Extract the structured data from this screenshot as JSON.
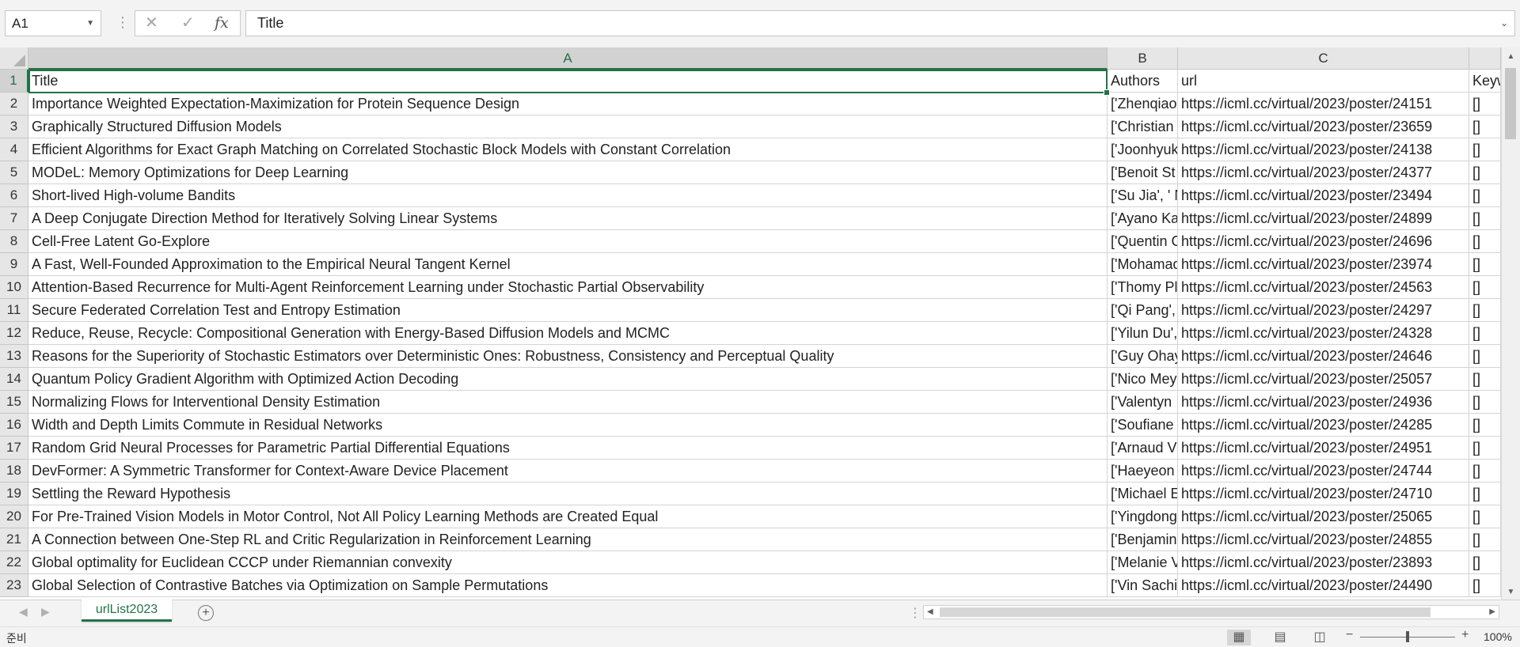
{
  "formula_bar": {
    "name_box": "A1",
    "cancel_icon": "✕",
    "enter_icon": "✓",
    "fx_label": "fx",
    "formula": "Title"
  },
  "columns": [
    {
      "id": "A",
      "label": "A"
    },
    {
      "id": "B",
      "label": "B"
    },
    {
      "id": "C",
      "label": "C"
    },
    {
      "id": "D",
      "label": ""
    }
  ],
  "rows": [
    {
      "num": "1",
      "cells": [
        "Title",
        "Authors",
        "url",
        "Keyw"
      ]
    },
    {
      "num": "2",
      "cells": [
        "Importance Weighted Expectation-Maximization for Protein Sequence Design",
        "['Zhenqiao",
        "https://icml.cc/virtual/2023/poster/24151",
        "[]"
      ]
    },
    {
      "num": "3",
      "cells": [
        "Graphically Structured Diffusion Models",
        "['Christian",
        "https://icml.cc/virtual/2023/poster/23659",
        "[]"
      ]
    },
    {
      "num": "4",
      "cells": [
        "Efficient Algorithms for Exact Graph Matching on Correlated Stochastic Block Models with Constant Correlation",
        "['Joonhyuk",
        "https://icml.cc/virtual/2023/poster/24138",
        "[]"
      ]
    },
    {
      "num": "5",
      "cells": [
        "MODeL: Memory Optimizations for Deep Learning",
        "['Benoit St",
        "https://icml.cc/virtual/2023/poster/24377",
        "[]"
      ]
    },
    {
      "num": "6",
      "cells": [
        "Short-lived High-volume Bandits",
        "['Su Jia', ' N",
        "https://icml.cc/virtual/2023/poster/23494",
        "[]"
      ]
    },
    {
      "num": "7",
      "cells": [
        "A Deep Conjugate Direction Method for Iteratively Solving Linear Systems",
        "['Ayano Ka",
        "https://icml.cc/virtual/2023/poster/24899",
        "[]"
      ]
    },
    {
      "num": "8",
      "cells": [
        "Cell-Free Latent Go-Explore",
        "['Quentin G",
        "https://icml.cc/virtual/2023/poster/24696",
        "[]"
      ]
    },
    {
      "num": "9",
      "cells": [
        "A Fast, Well-Founded Approximation to the Empirical Neural Tangent Kernel",
        "['Mohamad",
        "https://icml.cc/virtual/2023/poster/23974",
        "[]"
      ]
    },
    {
      "num": "10",
      "cells": [
        "Attention-Based Recurrence for Multi-Agent Reinforcement Learning under Stochastic Partial Observability",
        "['Thomy Pl",
        "https://icml.cc/virtual/2023/poster/24563",
        "[]"
      ]
    },
    {
      "num": "11",
      "cells": [
        "Secure Federated Correlation Test and Entropy Estimation",
        "['Qi Pang',",
        "https://icml.cc/virtual/2023/poster/24297",
        "[]"
      ]
    },
    {
      "num": "12",
      "cells": [
        "Reduce, Reuse, Recycle: Compositional Generation with Energy-Based Diffusion Models and MCMC",
        "['Yilun Du',",
        "https://icml.cc/virtual/2023/poster/24328",
        "[]"
      ]
    },
    {
      "num": "13",
      "cells": [
        "Reasons for the Superiority of Stochastic Estimators over Deterministic Ones: Robustness, Consistency and Perceptual Quality",
        "['Guy Ohay",
        "https://icml.cc/virtual/2023/poster/24646",
        "[]"
      ]
    },
    {
      "num": "14",
      "cells": [
        "Quantum Policy Gradient Algorithm with Optimized Action Decoding",
        "['Nico Mey",
        "https://icml.cc/virtual/2023/poster/25057",
        "[]"
      ]
    },
    {
      "num": "15",
      "cells": [
        "Normalizing Flows for Interventional Density Estimation",
        "['Valentyn",
        "https://icml.cc/virtual/2023/poster/24936",
        "[]"
      ]
    },
    {
      "num": "16",
      "cells": [
        "Width and Depth Limits Commute in Residual Networks",
        "['Soufiane",
        "https://icml.cc/virtual/2023/poster/24285",
        "[]"
      ]
    },
    {
      "num": "17",
      "cells": [
        "Random Grid Neural Processes for Parametric Partial Differential Equations",
        "['Arnaud V",
        "https://icml.cc/virtual/2023/poster/24951",
        "[]"
      ]
    },
    {
      "num": "18",
      "cells": [
        "DevFormer: A Symmetric Transformer for Context-Aware Device Placement",
        "['Haeyeon",
        "https://icml.cc/virtual/2023/poster/24744",
        "[]"
      ]
    },
    {
      "num": "19",
      "cells": [
        "Settling the Reward Hypothesis",
        "['Michael E",
        "https://icml.cc/virtual/2023/poster/24710",
        "[]"
      ]
    },
    {
      "num": "20",
      "cells": [
        "For Pre-Trained Vision Models in Motor Control, Not All Policy Learning Methods are Created Equal",
        "['Yingdong",
        "https://icml.cc/virtual/2023/poster/25065",
        "[]"
      ]
    },
    {
      "num": "21",
      "cells": [
        "A Connection between One-Step RL and Critic Regularization in Reinforcement Learning",
        "['Benjamin",
        "https://icml.cc/virtual/2023/poster/24855",
        "[]"
      ]
    },
    {
      "num": "22",
      "cells": [
        "Global optimality for Euclidean CCCP under Riemannian convexity",
        "['Melanie V",
        "https://icml.cc/virtual/2023/poster/23893",
        "[]"
      ]
    },
    {
      "num": "23",
      "cells": [
        "Global Selection of Contrastive Batches via Optimization on Sample Permutations",
        "['Vin Sachi",
        "https://icml.cc/virtual/2023/poster/24490",
        "[]"
      ]
    }
  ],
  "sheet_tabs": [
    {
      "label": "urlList2023"
    }
  ],
  "status_bar": {
    "ready": "준비",
    "zoom": "100%"
  },
  "accent_color": "#217346"
}
